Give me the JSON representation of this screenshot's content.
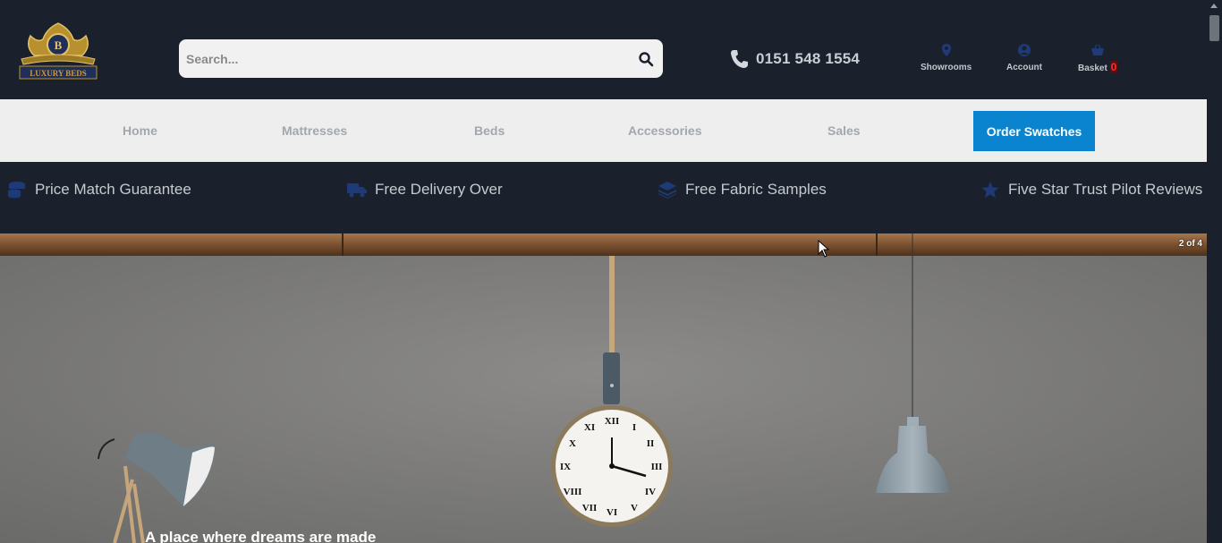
{
  "header": {
    "logo_text": "LUXURY BEDS",
    "search": {
      "placeholder": "Search...",
      "value": ""
    },
    "phone": "0151 548 1554",
    "links": [
      {
        "label": "Showrooms",
        "icon": "map-pin-icon"
      },
      {
        "label": "Account",
        "icon": "user-icon"
      },
      {
        "label": "Basket",
        "icon": "basket-icon",
        "count": "0"
      }
    ]
  },
  "nav": {
    "items": [
      "Home",
      "Mattresses",
      "Beds",
      "Accessories",
      "Sales"
    ],
    "cta": "Order Swatches"
  },
  "usps": [
    {
      "label": "Price Match Guarantee",
      "icon": "coins-icon"
    },
    {
      "label": "Free Delivery Over",
      "icon": "truck-icon"
    },
    {
      "label": "Free Fabric Samples",
      "icon": "layers-icon"
    },
    {
      "label": "Five Star Trust Pilot Reviews",
      "icon": "star-icon"
    }
  ],
  "hero": {
    "slide_counter": "2 of 4",
    "caption": "A place where dreams are made"
  },
  "colors": {
    "dark_bg": "#1b212c",
    "nav_bg": "#eeeeee",
    "cta_blue": "#0a84cf",
    "usp_icon": "#1f3a78",
    "basket_count": "#ff2d2d"
  }
}
